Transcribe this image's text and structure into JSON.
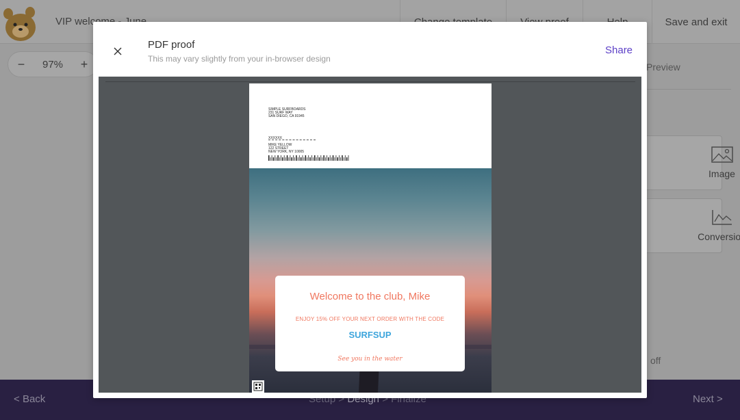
{
  "app": {
    "doc_title": "VIP welcome - June",
    "nav": [
      "Change template",
      "View proof",
      "Help",
      "Save and exit"
    ],
    "zoom": {
      "minus": "−",
      "value": "97%",
      "plus": "+"
    }
  },
  "side_panel": {
    "tab": "Preview",
    "cards": [
      {
        "label": "Image",
        "icon": "image-icon"
      },
      {
        "label": "Conversion",
        "icon": "line-chart-icon"
      }
    ],
    "toggle_text": "off"
  },
  "footer": {
    "back": "Back",
    "steps": [
      "Setup",
      "Design",
      "Finalize"
    ],
    "current_step": "Design",
    "separator": ">",
    "next": "Next"
  },
  "modal": {
    "title": "PDF proof",
    "subtitle": "This may vary slightly from your in-browser design",
    "share": "Share",
    "close_icon": "close-icon"
  },
  "mailer": {
    "return_address": [
      "SIMPLE SURFBOARDS",
      "231 SURF WAY",
      "SAN DIEGO, CA 91945"
    ],
    "placeholder": "XXXXXX",
    "recipient": [
      "MIKE YELLOW",
      "122 STREET",
      "NEW YORK, NY 10005"
    ],
    "heading": "Welcome to the club, Mike",
    "offer": "ENJOY 15% OFF YOUR NEXT ORDER WITH THE CODE",
    "code": "SURFSUP",
    "signoff": "See you in the water",
    "colors": {
      "accent": "#f0775f",
      "code": "#3da5dc",
      "share": "#5c3fc7",
      "footer": "#292042"
    }
  }
}
